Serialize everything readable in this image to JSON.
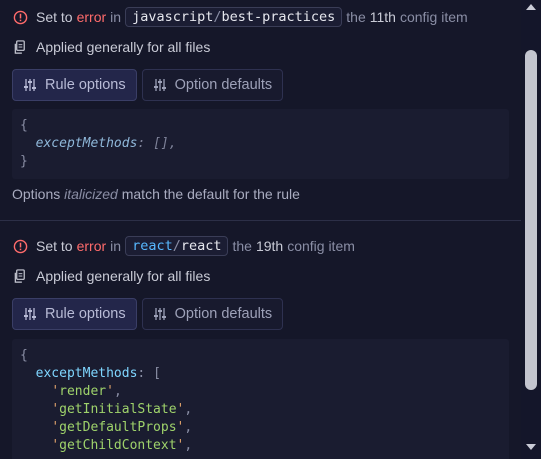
{
  "items": [
    {
      "set_to": "Set to",
      "severity": "error",
      "in": "in",
      "config_pkg": "javascript",
      "config_name": "best-practices",
      "the": "the",
      "ordinal": "11th",
      "config_item": "config item",
      "applied": "Applied generally for all files",
      "tab_rule_options": "Rule options",
      "tab_option_defaults": "Option defaults",
      "code": {
        "open": "{",
        "key": "exceptMethods",
        "colon": ":",
        "value": "[],",
        "close": "}"
      },
      "note_before": "Options",
      "note_italic": "italicized",
      "note_after": "match the default for the rule"
    },
    {
      "set_to": "Set to",
      "severity": "error",
      "in": "in",
      "config_pkg": "react",
      "config_name": "react",
      "the": "the",
      "ordinal": "19th",
      "config_item": "config item",
      "applied": "Applied generally for all files",
      "tab_rule_options": "Rule options",
      "tab_option_defaults": "Option defaults",
      "code": {
        "open": "{",
        "key": "exceptMethods",
        "colon": ":",
        "bracket": "[",
        "values": [
          "'render',",
          "'getInitialState',",
          "'getDefaultProps',",
          "'getChildContext',"
        ]
      }
    }
  ],
  "colors": {
    "background": "#151729",
    "error": "#ff6b6b",
    "accent_blue": "#57b8ff",
    "string": "#9fd36b"
  }
}
